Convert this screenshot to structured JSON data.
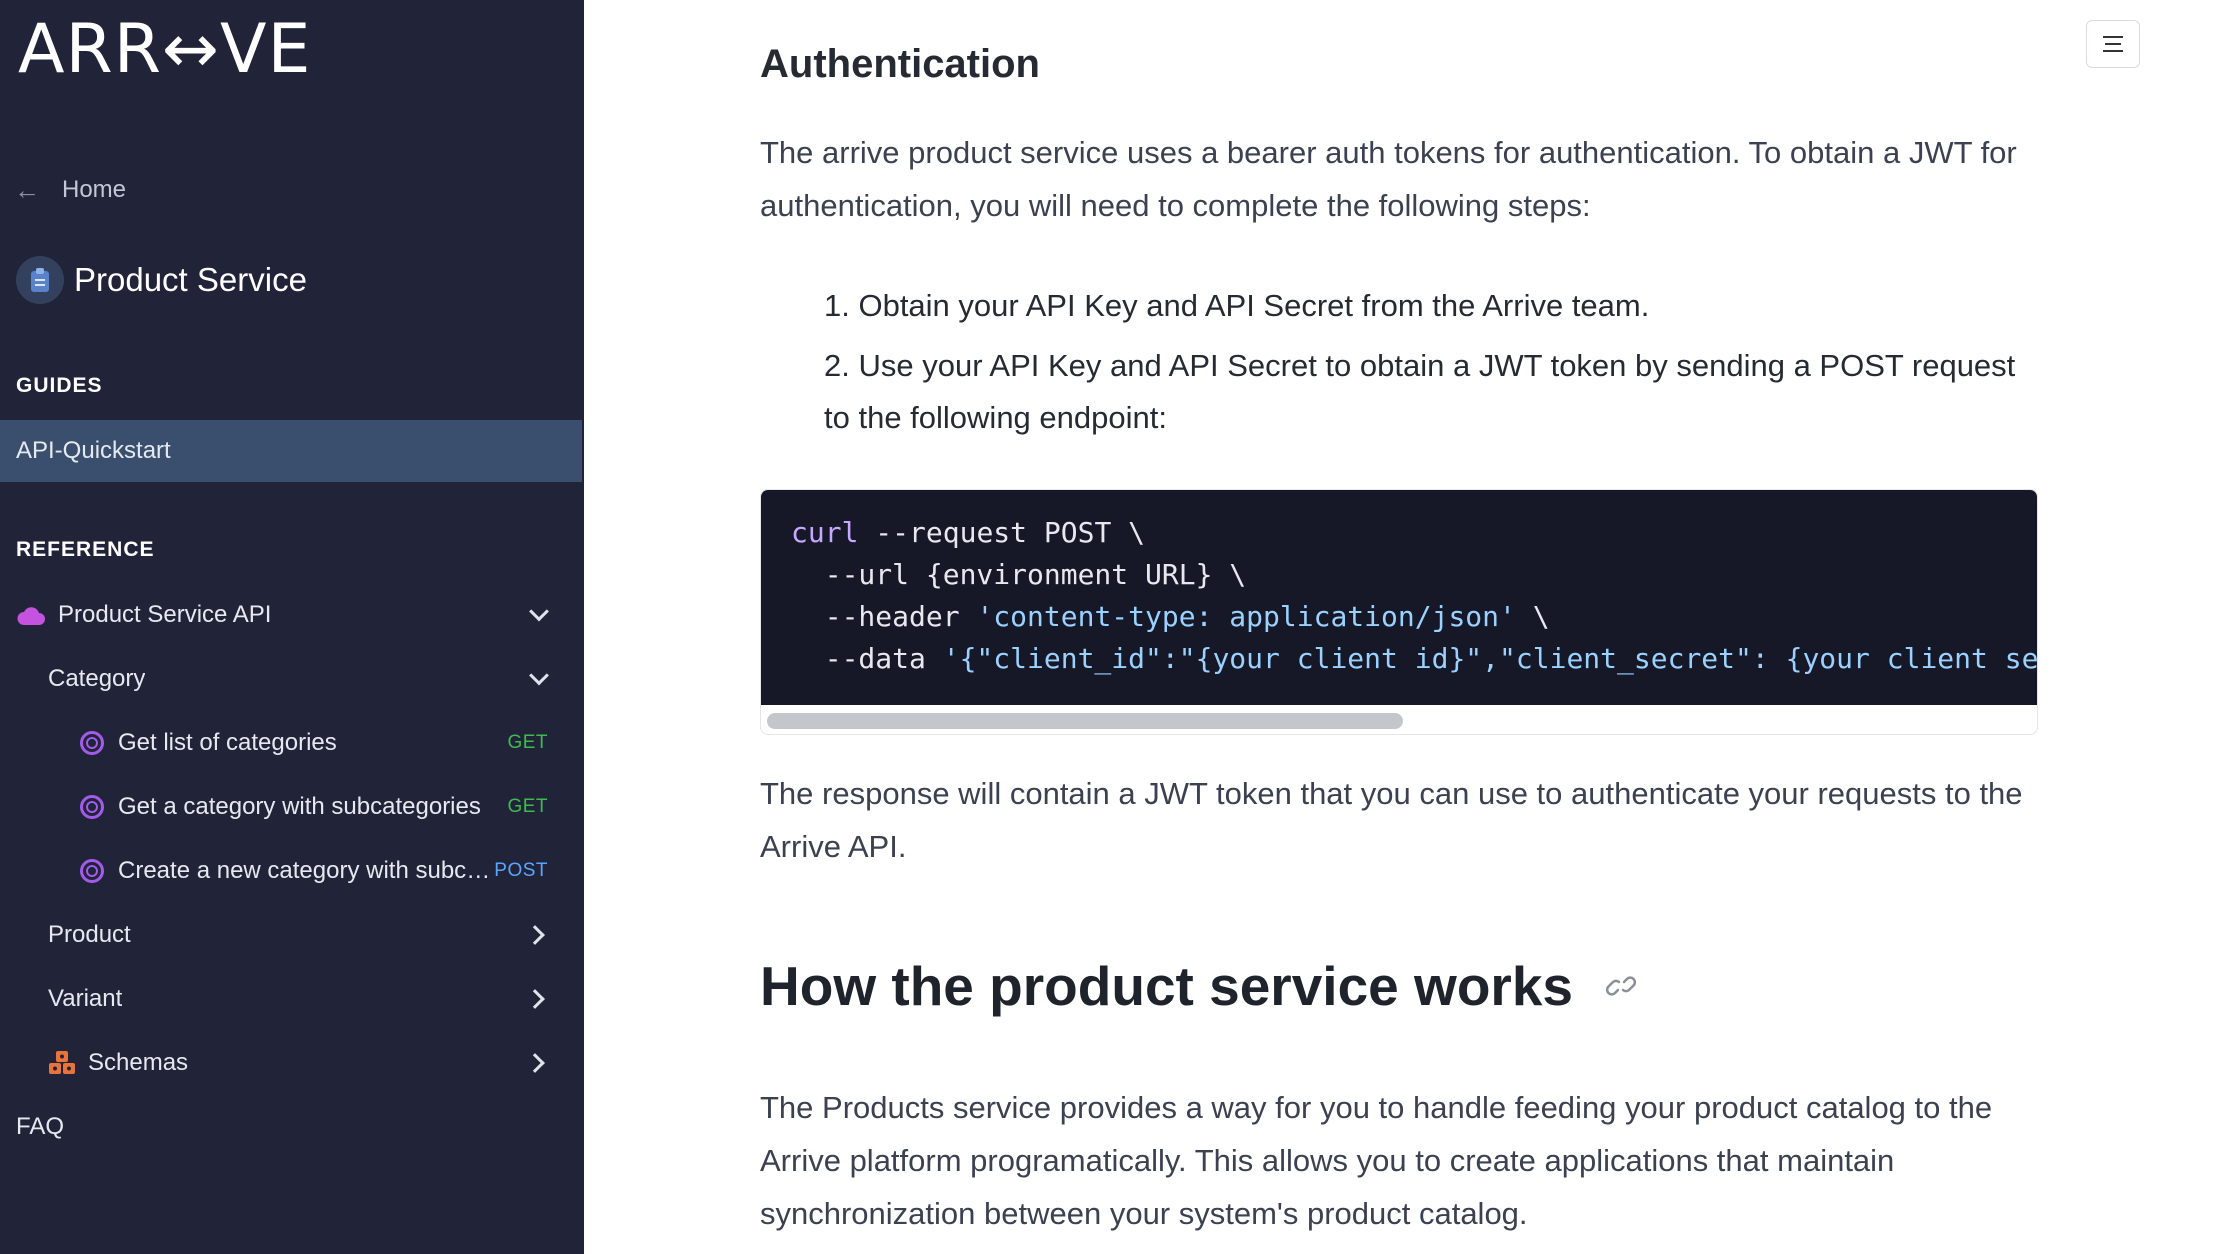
{
  "sidebar": {
    "logo": "ARR↔VE",
    "home_label": "Home",
    "service_title": "Product Service",
    "guides_label": "GUIDES",
    "guides": [
      {
        "label": "API-Quickstart",
        "active": true
      }
    ],
    "reference_label": "REFERENCE",
    "api_group": {
      "label": "Product Service API",
      "expanded": true
    },
    "category": {
      "label": "Category",
      "expanded": true
    },
    "endpoints": [
      {
        "label": "Get list of categories",
        "method": "GET"
      },
      {
        "label": "Get a category with subcategories",
        "method": "GET"
      },
      {
        "label": "Create a new category with subcategories",
        "method": "POST"
      }
    ],
    "groups": [
      {
        "label": "Product"
      },
      {
        "label": "Variant"
      },
      {
        "label": "Schemas"
      }
    ],
    "faq_label": "FAQ",
    "colors": {
      "background": "#212439",
      "active_item": "#3a4e6d",
      "get_method": "#3fb950",
      "post_method": "#58a6ff",
      "endpoint_icon": "#a35bea",
      "api_icon": "#c653e0",
      "schemas_icon": "#e8743b"
    }
  },
  "main": {
    "auth_heading": "Authentication",
    "auth_intro": "The arrive product service uses a bearer auth tokens for authentication. To obtain a JWT for authentication, you will need to complete the following steps:",
    "steps": [
      "1. Obtain your API Key and API Secret from the Arrive team.",
      "2. Use your API Key and API Secret to obtain a JWT token by sending a POST request to the following endpoint:"
    ],
    "code": {
      "line1_cmd": "curl",
      "line1_rest": " --request POST \\",
      "line2": "  --url {environment URL} \\",
      "line3_flag": "  --header ",
      "line3_str": "'content-type: application/json'",
      "line3_tail": " \\",
      "line4_flag": "  --data ",
      "line4_str": "'{\"client_id\":\"{your client id}\",\"client_secret\": {your client se"
    },
    "response_text": "The response will contain a JWT token that you can use to authenticate your requests to the Arrive API.",
    "how_heading": "How the product service works",
    "how_text": "The Products service provides a way for you to handle feeding your product catalog to the Arrive platform programatically. This allows you to create applications that maintain synchronization between your system's product catalog."
  }
}
